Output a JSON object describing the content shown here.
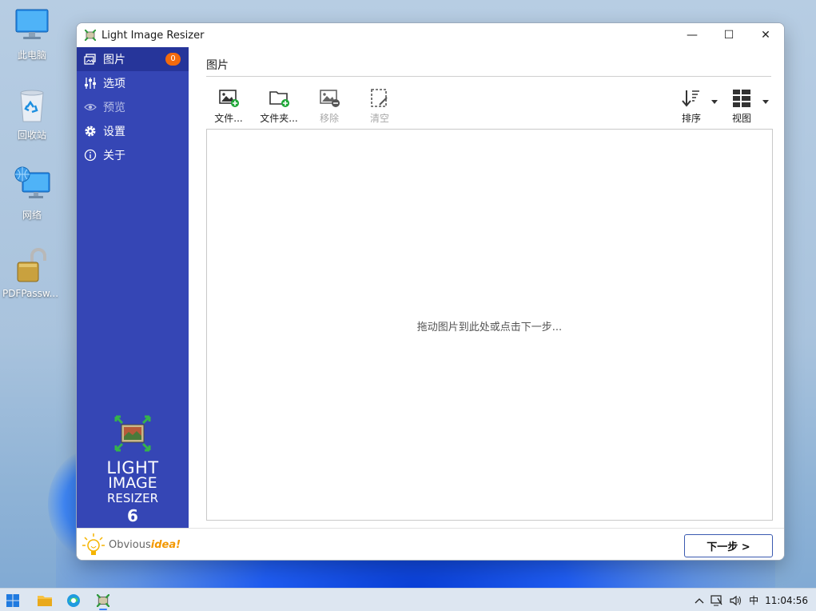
{
  "desktop": {
    "icons": [
      {
        "label": "此电脑",
        "icon": "computer-icon"
      },
      {
        "label": "回收站",
        "icon": "recycle-bin-icon"
      },
      {
        "label": "网络",
        "icon": "network-icon"
      },
      {
        "label": "PDFPassw...",
        "icon": "padlock-icon"
      }
    ]
  },
  "window": {
    "title": "Light Image Resizer",
    "controls": {
      "minimize": "—",
      "maximize": "☐",
      "close": "✕"
    }
  },
  "sidebar": {
    "items": [
      {
        "label": "图片",
        "icon": "images-icon",
        "badge": "0",
        "state": "active"
      },
      {
        "label": "选项",
        "icon": "sliders-icon",
        "state": "normal"
      },
      {
        "label": "预览",
        "icon": "eye-icon",
        "state": "disabled"
      },
      {
        "label": "设置",
        "icon": "gear-icon",
        "state": "normal"
      },
      {
        "label": "关于",
        "icon": "info-icon",
        "state": "normal"
      }
    ],
    "brand": {
      "line1": "LIGHT",
      "line2": "IMAGE",
      "line3": "RESIZER",
      "version": "6"
    },
    "vendor": {
      "text_plain": "Obvious",
      "text_accent": "idea!"
    }
  },
  "main": {
    "header": "图片",
    "toolbar": {
      "add_files": "文件...",
      "add_folder": "文件夹...",
      "remove": "移除",
      "clear": "清空",
      "sort": "排序",
      "view": "视图"
    },
    "drop_hint": "拖动图片到此处或点击下一步..."
  },
  "footer": {
    "next_label": "下一步 >"
  },
  "taskbar": {
    "apps": [
      "start-icon",
      "file-explorer-icon",
      "edge-icon",
      "light-image-resizer-icon"
    ],
    "tray": {
      "ime": "中",
      "time": "11:04:56"
    }
  },
  "colors": {
    "sidebar": "#3546b5",
    "sidebar_active": "#26359a",
    "badge": "#f46a0c",
    "accent": "#3a5ab0"
  }
}
